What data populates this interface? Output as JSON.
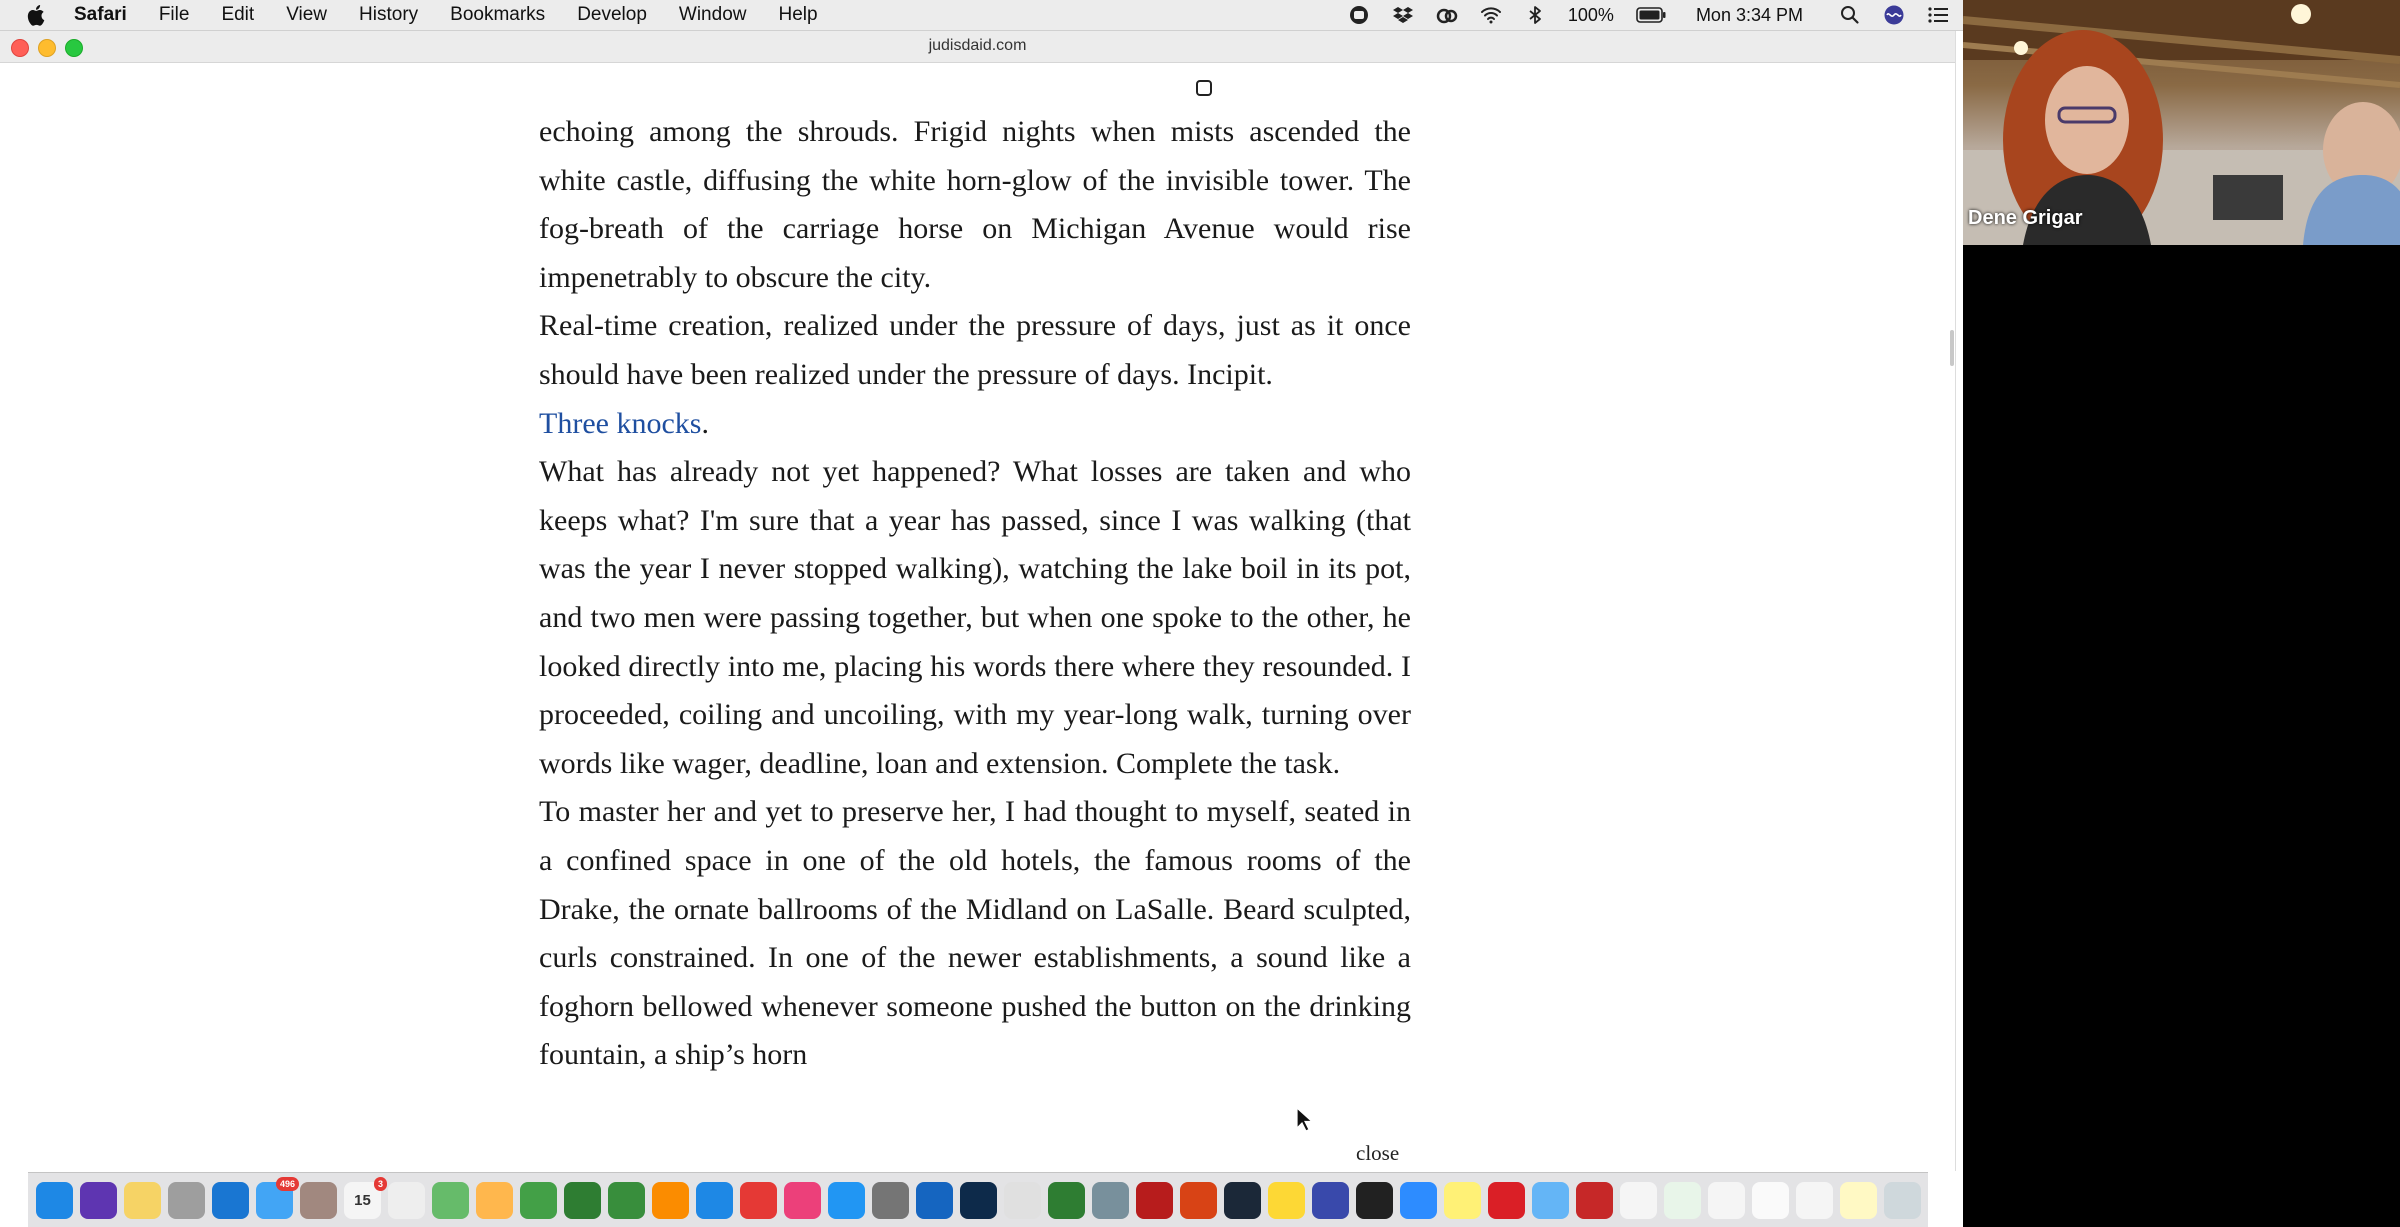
{
  "menubar": {
    "app_name": "Safari",
    "items": [
      "File",
      "Edit",
      "View",
      "History",
      "Bookmarks",
      "Develop",
      "Window",
      "Help"
    ],
    "battery": "100%",
    "clock": "Mon 3:34 PM"
  },
  "window": {
    "title": "judisdaid.com"
  },
  "article": {
    "p1": "echoing among the shrouds. Frigid nights when mists ascended the white castle, diffusing the white horn-glow of the invisible tower. The fog-breath of the carriage horse on Michigan Avenue would rise impenetrably to obscure the city.",
    "p2": "Real-time creation, realized under the pressure of days, just as it once should have been realized under the pressure of days. Incipit.",
    "p3_link": "Three knocks",
    "p3_tail": ".",
    "p4": "What has already not yet happened? What losses are taken and who keeps what? I'm sure that a year has passed, since I was walking (that was the year I never stopped walking), watching the lake boil in its pot, and two men were passing together, but when one spoke to the other, he looked directly into me, placing his words there where they resounded. I proceeded, coiling and uncoiling, with my year-long walk, turning over words like wager, deadline, loan and extension. Complete the task.",
    "p5": "To master her and yet to preserve her, I had thought to myself, seated in a confined space in one of the old hotels, the famous rooms of the Drake, the ornate ballrooms of the Midland on LaSalle. Beard sculpted, curls constrained. In one of the newer establishments, a sound like a foghorn bellowed whenever someone pushed the button on the drinking fountain, a ship’s horn",
    "close_label": "close"
  },
  "video": {
    "participant_name": "Dene Grigar"
  },
  "dock": {
    "calendar_day": "15",
    "badges": {
      "mail": "496",
      "calendar": "3"
    },
    "icons": [
      {
        "name": "finder-icon",
        "color": "#1e88e5"
      },
      {
        "name": "siri-icon",
        "color": "#5e35b1"
      },
      {
        "name": "notes-icon",
        "color": "#f6d365"
      },
      {
        "name": "launchpad-icon",
        "color": "#9e9e9e"
      },
      {
        "name": "safari-icon",
        "color": "#1976d2"
      },
      {
        "name": "mail-icon",
        "color": "#42a5f5"
      },
      {
        "name": "contacts-icon",
        "color": "#a1887f"
      },
      {
        "name": "calendar-icon",
        "color": "#f5f5f5"
      },
      {
        "name": "reminders-icon",
        "color": "#eeeeee"
      },
      {
        "name": "maps-icon",
        "color": "#66bb6a"
      },
      {
        "name": "photos-icon",
        "color": "#ffb74d"
      },
      {
        "name": "messages-icon",
        "color": "#43a047"
      },
      {
        "name": "facetime-icon",
        "color": "#2e7d32"
      },
      {
        "name": "numbers-icon",
        "color": "#388e3c"
      },
      {
        "name": "pages-icon",
        "color": "#fb8c00"
      },
      {
        "name": "keynote-icon",
        "color": "#1e88e5"
      },
      {
        "name": "news-icon",
        "color": "#e53935"
      },
      {
        "name": "music-icon",
        "color": "#ec407a"
      },
      {
        "name": "app-store-icon",
        "color": "#2196f3"
      },
      {
        "name": "system-preferences-icon",
        "color": "#757575"
      },
      {
        "name": "word-icon",
        "color": "#1565c0"
      },
      {
        "name": "photoshop-icon",
        "color": "#0d2a4a"
      },
      {
        "name": "dreamweaver-icon",
        "color": "#e0e0e0"
      },
      {
        "name": "excel-icon",
        "color": "#2e7d32"
      },
      {
        "name": "scanner-icon",
        "color": "#78909c"
      },
      {
        "name": "acrobat-icon",
        "color": "#b71c1c"
      },
      {
        "name": "powerpoint-icon",
        "color": "#d84315"
      },
      {
        "name": "steam-icon",
        "color": "#1b2838"
      },
      {
        "name": "cyberduck-icon",
        "color": "#fdd835"
      },
      {
        "name": "bbedit-icon",
        "color": "#3949ab"
      },
      {
        "name": "terminal-icon",
        "color": "#212121"
      },
      {
        "name": "zoom-icon",
        "color": "#2d8cff"
      },
      {
        "name": "stickies-icon",
        "color": "#fff176"
      },
      {
        "name": "creative-cloud-icon",
        "color": "#da1f26"
      },
      {
        "name": "downloads-folder-icon",
        "color": "#64b5f6"
      },
      {
        "name": "acrobat-doc-icon",
        "color": "#c62828"
      },
      {
        "name": "document-stack-1-icon",
        "color": "#f5f5f5"
      },
      {
        "name": "document-stack-2-icon",
        "color": "#e8f5e9"
      },
      {
        "name": "document-stack-3-icon",
        "color": "#f5f5f5"
      },
      {
        "name": "document-stack-4-icon",
        "color": "#fafafa"
      },
      {
        "name": "document-stack-5-icon",
        "color": "#f5f5f5"
      },
      {
        "name": "document-stack-6-icon",
        "color": "#fff9c4"
      },
      {
        "name": "trash-icon",
        "color": "#cfd8dc"
      }
    ]
  }
}
